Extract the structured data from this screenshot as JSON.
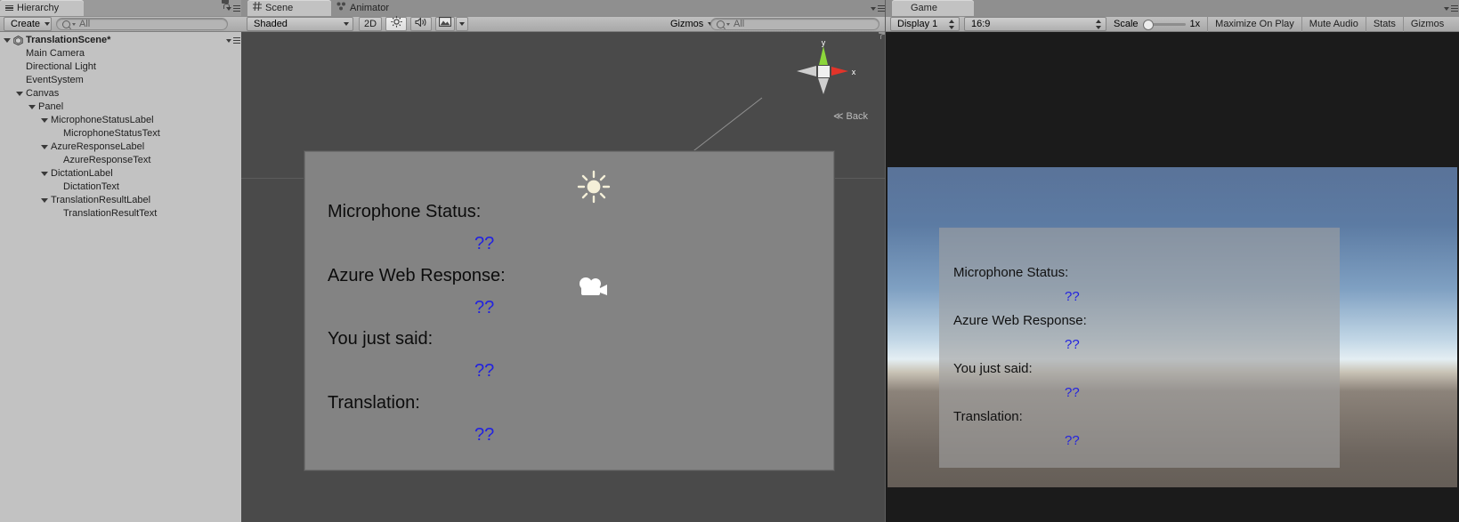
{
  "hierarchy": {
    "tab_label": "Hierarchy",
    "tab_icon": "hierarchy-icon",
    "create_label": "Create",
    "search_placeholder": "All",
    "search_value": "",
    "scene_name": "TranslationScene*",
    "items": [
      {
        "label": "Main Camera",
        "depth": 1,
        "expandable": false
      },
      {
        "label": "Directional Light",
        "depth": 1,
        "expandable": false
      },
      {
        "label": "EventSystem",
        "depth": 1,
        "expandable": false
      },
      {
        "label": "Canvas",
        "depth": 1,
        "expandable": true
      },
      {
        "label": "Panel",
        "depth": 2,
        "expandable": true
      },
      {
        "label": "MicrophoneStatusLabel",
        "depth": 3,
        "expandable": true
      },
      {
        "label": "MicrophoneStatusText",
        "depth": 4,
        "expandable": false
      },
      {
        "label": "AzureResponseLabel",
        "depth": 3,
        "expandable": true
      },
      {
        "label": "AzureResponseText",
        "depth": 4,
        "expandable": false
      },
      {
        "label": "DictationLabel",
        "depth": 3,
        "expandable": true
      },
      {
        "label": "DictationText",
        "depth": 4,
        "expandable": false
      },
      {
        "label": "TranslationResultLabel",
        "depth": 3,
        "expandable": true
      },
      {
        "label": "TranslationResultText",
        "depth": 4,
        "expandable": false
      }
    ]
  },
  "scene": {
    "tabs": [
      {
        "label": "Scene",
        "icon": "grid-icon",
        "active": true
      },
      {
        "label": "Animator",
        "icon": "animator-icon",
        "active": false
      }
    ],
    "toolbar": {
      "draw_mode": "Shaded",
      "two_d_label": "2D",
      "lighting_icon": "sun-icon",
      "audio_icon": "speaker-icon",
      "effects_icon": "image-icon",
      "gizmos_label": "Gizmos",
      "search_placeholder": "All",
      "search_value": ""
    },
    "gizmo": {
      "back_label": "Back",
      "y_axis_label": "y",
      "x_axis_label": "x",
      "y_axis_color": "#8cd63b",
      "x_axis_color": "#e2342a",
      "lock_icon": "lock-icon"
    },
    "gizmos_in_view": [
      {
        "name": "directional-light-gizmo",
        "icon": "sun-icon"
      },
      {
        "name": "main-camera-gizmo",
        "icon": "camera-icon"
      }
    ],
    "ui_panel": {
      "rows": [
        {
          "label": "Microphone Status:",
          "value": "??"
        },
        {
          "label": "Azure Web Response:",
          "value": "??"
        },
        {
          "label": "You just said:",
          "value": "??"
        },
        {
          "label": "Translation:",
          "value": "??"
        }
      ]
    }
  },
  "game": {
    "tab_label": "Game",
    "tab_icon": "game-icon",
    "toolbar": {
      "display": "Display 1",
      "aspect": "16:9",
      "scale_label": "Scale",
      "scale_value": "1x",
      "maximize_label": "Maximize On Play",
      "mute_label": "Mute Audio",
      "stats_label": "Stats",
      "gizmos_label": "Gizmos"
    },
    "ui_panel": {
      "rows": [
        {
          "label": "Microphone Status:",
          "value": "??"
        },
        {
          "label": "Azure Web Response:",
          "value": "??"
        },
        {
          "label": "You just said:",
          "value": "??"
        },
        {
          "label": "Translation:",
          "value": "??"
        }
      ]
    }
  },
  "colors": {
    "label_text": "#0c0c0c",
    "value_text": "#2222e0",
    "panel_bg": "#838383",
    "editor_chrome": "#c2c2c2"
  }
}
